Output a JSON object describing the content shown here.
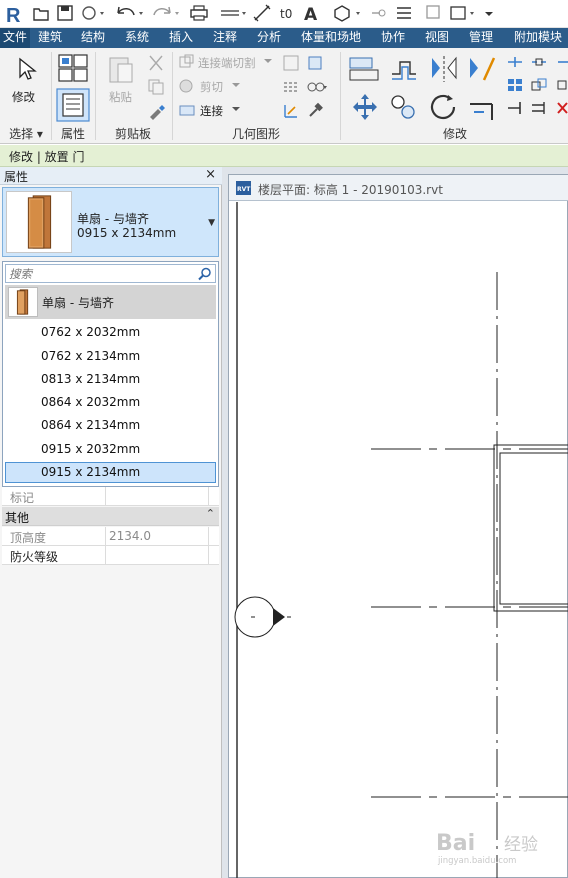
{
  "app": {
    "logo_letter": "R"
  },
  "ribbon": {
    "tabs": [
      {
        "label": "文件",
        "active": true
      },
      {
        "label": "建筑"
      },
      {
        "label": "结构"
      },
      {
        "label": "系统"
      },
      {
        "label": "插入"
      },
      {
        "label": "注释"
      },
      {
        "label": "分析"
      },
      {
        "label": "体量和场地"
      },
      {
        "label": "协作"
      },
      {
        "label": "视图"
      },
      {
        "label": "管理"
      },
      {
        "label": "附加模块"
      }
    ],
    "modify_label": "修改",
    "paste_label": "粘贴",
    "join_cut_label": "连接端切割",
    "cut_label": "剪切",
    "join_label": "连接",
    "panels": {
      "select": "选择",
      "properties": "属性",
      "clipboard": "剪贴板",
      "geometry": "几何图形",
      "modify": "修改"
    }
  },
  "context_bar": {
    "text": "修改 | 放置 门"
  },
  "properties": {
    "title": "属性",
    "close_glyph": "×",
    "type_selector": {
      "family": "单扇 - 与墙齐",
      "type": "0915 x 2134mm"
    },
    "dropdown": {
      "search_placeholder": "搜索",
      "family": "单扇 - 与墙齐",
      "items": [
        {
          "label": "0762 x 2032mm"
        },
        {
          "label": "0762 x 2134mm"
        },
        {
          "label": "0813 x 2134mm"
        },
        {
          "label": "0864 x 2032mm"
        },
        {
          "label": "0864 x 2134mm"
        },
        {
          "label": "0915 x 2032mm"
        },
        {
          "label": "0915 x 2134mm",
          "selected": true
        }
      ]
    },
    "grid": {
      "mark_label": "标记",
      "group_other": "其他",
      "group_toggle": "⌃",
      "head_height_label": "顶高度",
      "head_height_value": "2134.0",
      "fire_rating_label": "防火等级"
    }
  },
  "view": {
    "title": "楼层平面: 标高 1 - 20190103.rvt",
    "icon_text": "RVT"
  },
  "watermark": {
    "brand": "Bai",
    "brand2": "经验",
    "url": "jingyan.baidu.com"
  },
  "colors": {
    "tab_bar": "#2b5c8a",
    "context_bar": "#e4f0d4",
    "selection": "#cde4fb"
  }
}
